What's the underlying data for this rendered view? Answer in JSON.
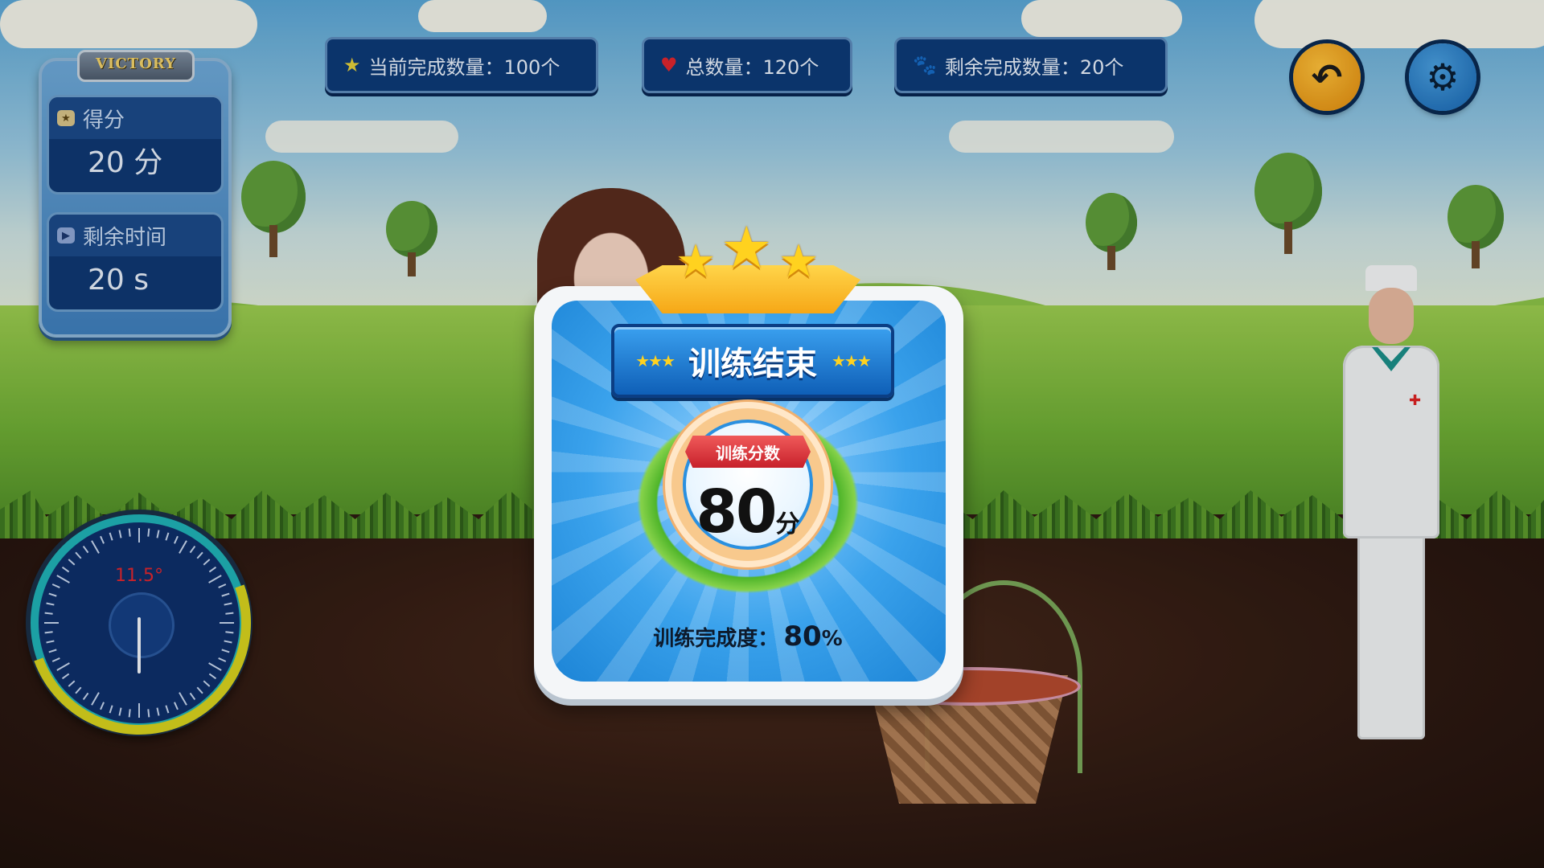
{
  "hud": {
    "badge": "VICTORY",
    "score_label": "得分",
    "score_value": "20 分",
    "time_label": "剩余时间",
    "time_value": "20 s"
  },
  "top_bar": {
    "current": "当前完成数量：100个",
    "total": "总数量：120个",
    "remaining": "剩余完成数量：20个"
  },
  "gauge": {
    "reading": "11.5°",
    "angle_degrees": 11.5
  },
  "result": {
    "title": "训练结束",
    "score_label": "训练分数",
    "score": "80",
    "score_unit": "分",
    "completion_label": "训练完成度：",
    "completion_value": "80",
    "completion_unit": "%",
    "stars": 3
  },
  "icons": {
    "score": "coin-icon",
    "time": "play-icon",
    "current": "star-icon",
    "total": "heart-icon",
    "remaining": "paw-icon",
    "back": "back-arrow-icon",
    "settings": "gear-icon"
  },
  "colors": {
    "panel": "#0d3a78",
    "accent_orange": "#f6a716",
    "accent_red": "#c7212b",
    "modal_blue": "#1c84d6"
  }
}
